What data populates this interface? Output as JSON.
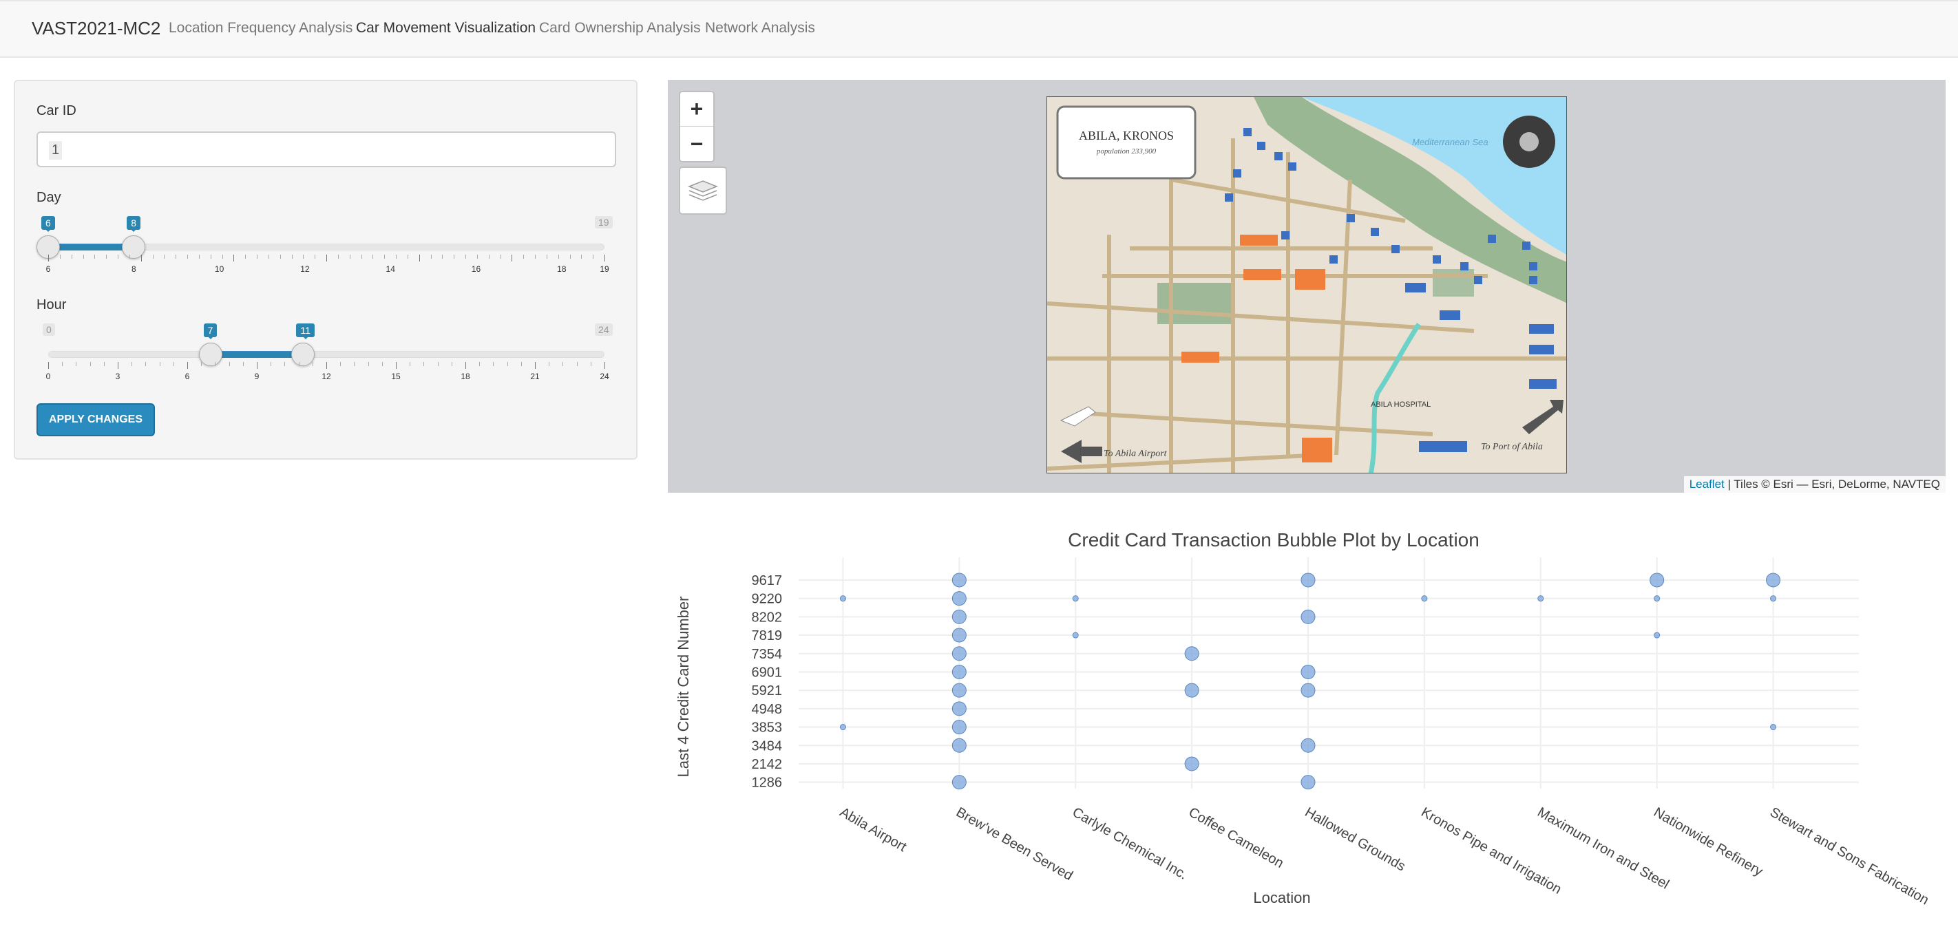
{
  "navbar": {
    "brand": "VAST2021-MC2",
    "tabs": [
      {
        "label": "Location Frequency Analysis",
        "active": false
      },
      {
        "label": "Car Movement Visualization",
        "active": true
      },
      {
        "label": "Card Ownership Analysis",
        "active": false
      },
      {
        "label": "Network Analysis",
        "active": false
      }
    ]
  },
  "sidebar": {
    "car_id": {
      "label": "Car ID",
      "value": "1"
    },
    "day": {
      "label": "Day",
      "min": 6,
      "max": 19,
      "from": 6,
      "to": 8,
      "ticks": [
        "6",
        "8",
        "10",
        "12",
        "14",
        "16",
        "18",
        "19"
      ]
    },
    "hour": {
      "label": "Hour",
      "min": 0,
      "max": 24,
      "from": 7,
      "to": 11,
      "ticks": [
        "0",
        "3",
        "6",
        "9",
        "12",
        "15",
        "18",
        "21",
        "24"
      ]
    },
    "apply_label": "APPLY CHANGES"
  },
  "map": {
    "zoom_in": "+",
    "zoom_out": "−",
    "layers_icon": "layers-icon",
    "attribution_link": "Leaflet",
    "attribution_text": " | Tiles © Esri — Esri, DeLorme, NAVTEQ",
    "tourist_map": {
      "title": "ABILA, KRONOS",
      "subtitle": "population 233,900",
      "sea_label": "Mediterranean Sea",
      "airport_label": "To Abila Airport",
      "port_label": "To Port of Abila",
      "hospital_label": "ABILA HOSPITAL",
      "colors": {
        "sea": "#9fdcf5",
        "land": "#e9e2d4",
        "park": "#7fa87f",
        "road": "#c9b48c",
        "marker": "#3b6fc4",
        "shop": "#f07f3c"
      }
    }
  },
  "chart_data": {
    "type": "scatter",
    "title": "Credit Card Transaction Bubble Plot by Location",
    "xlabel": "Location",
    "ylabel": "Last 4 Credit Card Number",
    "categories": [
      "Abila Airport",
      "Brew've Been Served",
      "Carlyle Chemical Inc.",
      "Coffee Cameleon",
      "Hallowed Grounds",
      "Kronos Pipe and Irrigation",
      "Maximum Iron and Steel",
      "Nationwide Refinery",
      "Stewart and Sons Fabrication"
    ],
    "y_tick_labels": [
      "1286",
      "2142",
      "3484",
      "3853",
      "4948",
      "5921",
      "6901",
      "7354",
      "7819",
      "8202",
      "9220",
      "9617"
    ],
    "marker_color": "#7ba6dc",
    "grid": true,
    "legend": "none",
    "points": [
      {
        "x": "Abila Airport",
        "y": "9220",
        "size": 1
      },
      {
        "x": "Abila Airport",
        "y": "3853",
        "size": 1
      },
      {
        "x": "Brew've Been Served",
        "y": "9617",
        "size": 3
      },
      {
        "x": "Brew've Been Served",
        "y": "9220",
        "size": 3
      },
      {
        "x": "Brew've Been Served",
        "y": "8202",
        "size": 3
      },
      {
        "x": "Brew've Been Served",
        "y": "7819",
        "size": 3
      },
      {
        "x": "Brew've Been Served",
        "y": "7354",
        "size": 3
      },
      {
        "x": "Brew've Been Served",
        "y": "6901",
        "size": 3
      },
      {
        "x": "Brew've Been Served",
        "y": "5921",
        "size": 3
      },
      {
        "x": "Brew've Been Served",
        "y": "4948",
        "size": 3
      },
      {
        "x": "Brew've Been Served",
        "y": "3853",
        "size": 3
      },
      {
        "x": "Brew've Been Served",
        "y": "3484",
        "size": 3
      },
      {
        "x": "Brew've Been Served",
        "y": "1286",
        "size": 3
      },
      {
        "x": "Carlyle Chemical Inc.",
        "y": "9220",
        "size": 1
      },
      {
        "x": "Carlyle Chemical Inc.",
        "y": "7819",
        "size": 1
      },
      {
        "x": "Coffee Cameleon",
        "y": "7354",
        "size": 3
      },
      {
        "x": "Coffee Cameleon",
        "y": "5921",
        "size": 3
      },
      {
        "x": "Coffee Cameleon",
        "y": "2142",
        "size": 3
      },
      {
        "x": "Hallowed Grounds",
        "y": "9617",
        "size": 3
      },
      {
        "x": "Hallowed Grounds",
        "y": "8202",
        "size": 3
      },
      {
        "x": "Hallowed Grounds",
        "y": "6901",
        "size": 3
      },
      {
        "x": "Hallowed Grounds",
        "y": "5921",
        "size": 3
      },
      {
        "x": "Hallowed Grounds",
        "y": "3484",
        "size": 3
      },
      {
        "x": "Hallowed Grounds",
        "y": "1286",
        "size": 3
      },
      {
        "x": "Kronos Pipe and Irrigation",
        "y": "9220",
        "size": 1
      },
      {
        "x": "Maximum Iron and Steel",
        "y": "9220",
        "size": 1
      },
      {
        "x": "Nationwide Refinery",
        "y": "9617",
        "size": 3
      },
      {
        "x": "Nationwide Refinery",
        "y": "9220",
        "size": 1
      },
      {
        "x": "Nationwide Refinery",
        "y": "7819",
        "size": 1
      },
      {
        "x": "Stewart and Sons Fabrication",
        "y": "9617",
        "size": 3
      },
      {
        "x": "Stewart and Sons Fabrication",
        "y": "9220",
        "size": 1
      },
      {
        "x": "Stewart and Sons Fabrication",
        "y": "3853",
        "size": 1
      }
    ]
  }
}
